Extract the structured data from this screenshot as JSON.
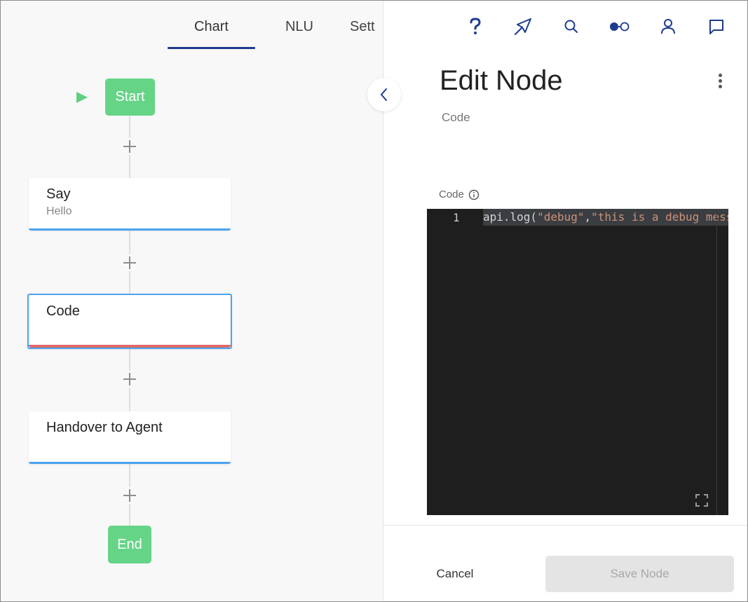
{
  "tabs": [
    {
      "label": "Chart",
      "active": true
    },
    {
      "label": "NLU",
      "active": false
    },
    {
      "label": "Sett",
      "active": false
    }
  ],
  "flow": {
    "start_label": "Start",
    "end_label": "End",
    "nodes": [
      {
        "title": "Say",
        "subtitle": "Hello",
        "selected": false
      },
      {
        "title": "Code",
        "subtitle": "",
        "selected": true
      },
      {
        "title": "Handover to Agent",
        "subtitle": "",
        "selected": false
      }
    ]
  },
  "topbar": {
    "icons": [
      "help-icon",
      "compass-icon",
      "search-icon",
      "toggle-icon",
      "user-icon",
      "chat-icon"
    ]
  },
  "panel": {
    "title": "Edit Node",
    "subtitle": "Code",
    "field_label": "Code",
    "editor": {
      "line_number": "1",
      "code_prefix": "api.log(",
      "code_arg1": "\"debug\"",
      "code_sep": ",",
      "code_arg2": "\"this is a debug mess"
    },
    "cancel_label": "Cancel",
    "save_label": "Save Node"
  },
  "colors": {
    "accent": "#1d3b8f",
    "node_green": "#66d487",
    "node_bar": "#4aa3ef",
    "error_bar": "#e06a6a",
    "editor_bg": "#1e1e1e",
    "code_string": "#ce9178"
  }
}
